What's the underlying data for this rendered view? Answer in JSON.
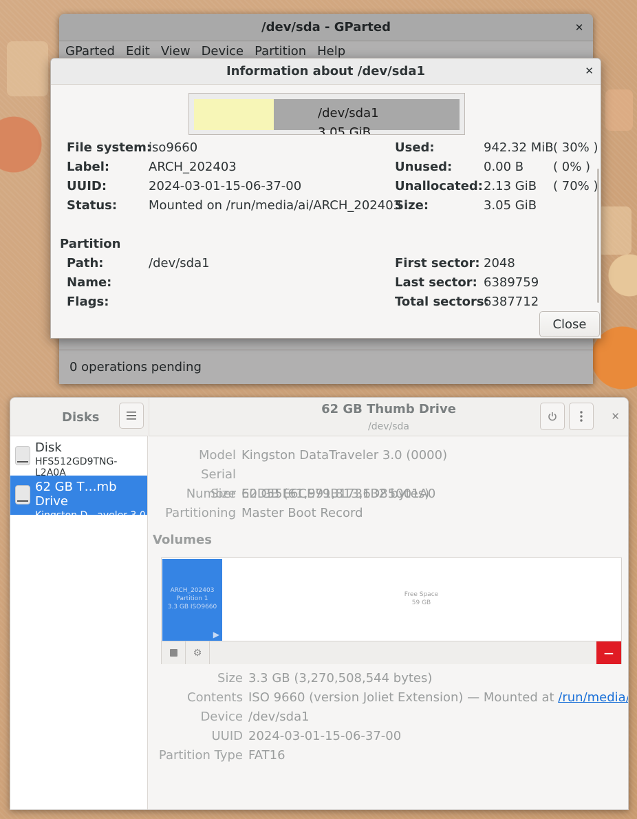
{
  "gparted": {
    "title": "/dev/sda - GParted",
    "menu": [
      "GParted",
      "Edit",
      "View",
      "Device",
      "Partition",
      "Help"
    ],
    "status": "0 operations pending"
  },
  "dialog": {
    "title": "Information about /dev/sda1",
    "bar_name": "/dev/sda1",
    "bar_size": "3.05 GiB",
    "used_fraction": 0.3,
    "filesystem": {
      "label": "File system:",
      "value": "iso9660"
    },
    "label": {
      "label": "Label:",
      "value": "ARCH_202403"
    },
    "uuid": {
      "label": "UUID:",
      "value": "2024-03-01-15-06-37-00"
    },
    "status": {
      "label": "Status:",
      "value": "Mounted on /run/media/ai/ARCH_202403"
    },
    "used": {
      "label": "Used:",
      "value": "942.32 MiB",
      "pct": "( 30% )"
    },
    "unused": {
      "label": "Unused:",
      "value": "0.00 B",
      "pct": "( 0% )"
    },
    "unallocated": {
      "label": "Unallocated:",
      "value": "2.13 GiB",
      "pct": "( 70% )"
    },
    "size": {
      "label": "Size:",
      "value": "3.05 GiB"
    },
    "partition_heading": "Partition",
    "path": {
      "label": "Path:",
      "value": "/dev/sda1"
    },
    "name": {
      "label": "Name:",
      "value": ""
    },
    "flags": {
      "label": "Flags:",
      "value": ""
    },
    "first_sector": {
      "label": "First sector:",
      "value": "2048"
    },
    "last_sector": {
      "label": "Last sector:",
      "value": "6389759"
    },
    "total_sectors": {
      "label": "Total sectors:",
      "value": "6387712"
    },
    "close_label": "Close"
  },
  "disks": {
    "sidebar_title": "Disks",
    "title": "62 GB Thumb Drive",
    "subtitle": "/dev/sda",
    "drives": [
      {
        "name": "Disk",
        "desc": "HFS512GD9TNG-L2A0A"
      },
      {
        "name": "62 GB T…mb Drive",
        "desc": "Kingston D…aveler 3.0"
      }
    ],
    "model": {
      "label": "Model",
      "value": "Kingston DataTraveler 3.0 (0000)"
    },
    "serial": {
      "label": "Serial Number",
      "value": "E0D55E6CE79B1731D85001A0"
    },
    "size": {
      "label": "Size",
      "value": "62 GB (61,991,813,632 bytes)"
    },
    "partitioning": {
      "label": "Partitioning",
      "value": "Master Boot Record"
    },
    "volumes_heading": "Volumes",
    "vol_part": {
      "line1": "ARCH_202403",
      "line2": "Partition 1",
      "line3": "3.3 GB ISO9660"
    },
    "vol_free": {
      "line1": "Free Space",
      "line2": "59 GB"
    },
    "vsize": {
      "label": "Size",
      "value": "3.3 GB (3,270,508,544 bytes)"
    },
    "contents": {
      "label": "Contents",
      "value": "ISO 9660 (version Joliet Extension) — Mounted at ",
      "link": "/run/media/…"
    },
    "device": {
      "label": "Device",
      "value": "/dev/sda1"
    },
    "uuid": {
      "label": "UUID",
      "value": "2024-03-01-15-06-37-00"
    },
    "ptype": {
      "label": "Partition Type",
      "value": "FAT16"
    }
  }
}
